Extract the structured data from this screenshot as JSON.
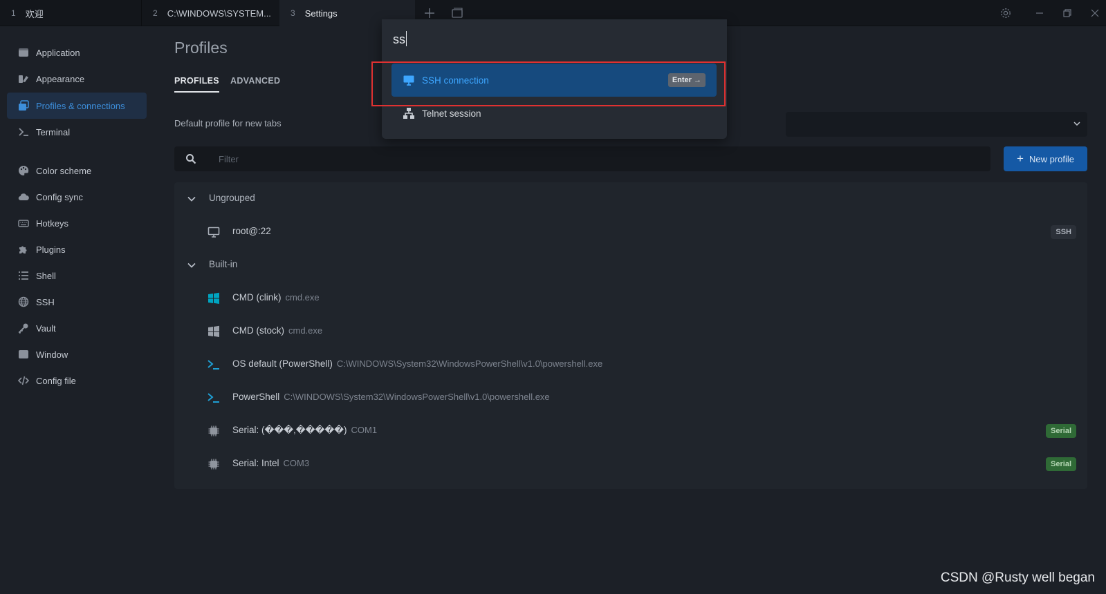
{
  "tabs": [
    {
      "num": "1",
      "label": "欢迎"
    },
    {
      "num": "2",
      "label": "C:\\WINDOWS\\SYSTEM..."
    },
    {
      "num": "3",
      "label": "Settings"
    }
  ],
  "sidebar": {
    "items": [
      {
        "label": "Application",
        "icon": "application-icon"
      },
      {
        "label": "Appearance",
        "icon": "appearance-icon"
      },
      {
        "label": "Profiles & connections",
        "icon": "profiles-icon",
        "active": true
      },
      {
        "label": "Terminal",
        "icon": "terminal-icon"
      },
      {
        "label": "Color scheme",
        "icon": "palette-icon"
      },
      {
        "label": "Config sync",
        "icon": "cloud-icon"
      },
      {
        "label": "Hotkeys",
        "icon": "keyboard-icon"
      },
      {
        "label": "Plugins",
        "icon": "puzzle-icon"
      },
      {
        "label": "Shell",
        "icon": "list-icon"
      },
      {
        "label": "SSH",
        "icon": "globe-icon"
      },
      {
        "label": "Vault",
        "icon": "key-icon"
      },
      {
        "label": "Window",
        "icon": "window-icon"
      },
      {
        "label": "Config file",
        "icon": "code-icon"
      }
    ]
  },
  "main": {
    "title": "Profiles",
    "subtabs": [
      "PROFILES",
      "ADVANCED"
    ],
    "default_profile_label": "Default profile for new tabs",
    "filter_placeholder": "Filter",
    "new_profile_label": "New profile"
  },
  "profiles": {
    "groups": [
      {
        "name": "Ungrouped",
        "items": [
          {
            "name": "root@:22",
            "desc": "",
            "icon": "monitor-icon",
            "badge": "SSH",
            "badge_type": "ssh"
          }
        ]
      },
      {
        "name": "Built-in",
        "items": [
          {
            "name": "CMD (clink)",
            "desc": "cmd.exe",
            "icon": "windows-color-icon",
            "badge": "",
            "badge_type": ""
          },
          {
            "name": "CMD (stock)",
            "desc": "cmd.exe",
            "icon": "windows-gray-icon",
            "badge": "",
            "badge_type": ""
          },
          {
            "name": "OS default (PowerShell)",
            "desc": "C:\\WINDOWS\\System32\\WindowsPowerShell\\v1.0\\powershell.exe",
            "icon": "powershell-icon",
            "badge": "",
            "badge_type": ""
          },
          {
            "name": "PowerShell",
            "desc": "C:\\WINDOWS\\System32\\WindowsPowerShell\\v1.0\\powershell.exe",
            "icon": "powershell-icon",
            "badge": "",
            "badge_type": ""
          },
          {
            "name": "Serial: (���,�����)",
            "desc": "COM1",
            "icon": "chip-icon",
            "badge": "Serial",
            "badge_type": "serial"
          },
          {
            "name": "Serial: Intel",
            "desc": "COM3",
            "icon": "chip-icon",
            "badge": "Serial",
            "badge_type": "serial"
          }
        ]
      }
    ]
  },
  "palette": {
    "query": "ss",
    "options": [
      {
        "label": "SSH connection",
        "icon": "monitor-icon",
        "hint": "Enter →",
        "selected": true
      },
      {
        "label": "Telnet session",
        "icon": "network-icon",
        "hint": "",
        "selected": false
      }
    ]
  },
  "watermark": "CSDN @Rusty well began",
  "colors": {
    "accent": "#3d8fdc",
    "button": "#1559a5",
    "serial_badge": "#2f6a36",
    "highlight": "#e03131"
  }
}
